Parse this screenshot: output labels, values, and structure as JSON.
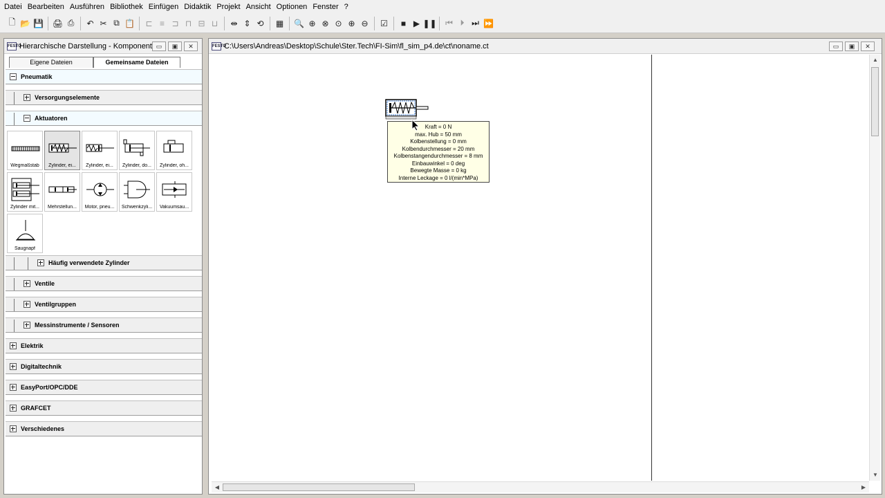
{
  "menu": [
    "Datei",
    "Bearbeiten",
    "Ausführen",
    "Bibliothek",
    "Einfügen",
    "Didaktik",
    "Projekt",
    "Ansicht",
    "Optionen",
    "Fenster",
    "?"
  ],
  "toolbar": {
    "groups": [
      [
        {
          "name": "new-file-icon",
          "glyph": "🗋"
        },
        {
          "name": "open-folder-icon",
          "glyph": "📂"
        },
        {
          "name": "save-icon",
          "glyph": "💾"
        }
      ],
      [
        {
          "name": "print-preview-icon",
          "glyph": "🖨"
        },
        {
          "name": "print-icon",
          "glyph": "⎙"
        }
      ],
      [
        {
          "name": "undo-icon",
          "glyph": "↶"
        },
        {
          "name": "cut-icon",
          "glyph": "✂"
        },
        {
          "name": "copy-icon",
          "glyph": "⧉"
        },
        {
          "name": "paste-icon",
          "glyph": "📋"
        }
      ],
      [
        {
          "name": "align-left-icon",
          "glyph": "⊏",
          "dim": true
        },
        {
          "name": "align-center-icon",
          "glyph": "≡",
          "dim": true
        },
        {
          "name": "align-right-icon",
          "glyph": "⊐",
          "dim": true
        },
        {
          "name": "align-top-icon",
          "glyph": "⊓",
          "dim": true
        },
        {
          "name": "align-middle-icon",
          "glyph": "⊟",
          "dim": true
        },
        {
          "name": "align-bottom-icon",
          "glyph": "⊔",
          "dim": true
        }
      ],
      [
        {
          "name": "flip-horizontal-icon",
          "glyph": "⇹"
        },
        {
          "name": "flip-vertical-icon",
          "glyph": "⇕"
        },
        {
          "name": "rotate-icon",
          "glyph": "⟲"
        }
      ],
      [
        {
          "name": "grid-icon",
          "glyph": "▦"
        }
      ],
      [
        {
          "name": "zoom-icon",
          "glyph": "🔍"
        },
        {
          "name": "zoom-fit-icon",
          "glyph": "⊕"
        },
        {
          "name": "zoom-area-icon",
          "glyph": "⊗"
        },
        {
          "name": "zoom-window-icon",
          "glyph": "⊙"
        },
        {
          "name": "zoom-in-icon",
          "glyph": "⊕"
        },
        {
          "name": "zoom-out-icon",
          "glyph": "⊖"
        }
      ],
      [
        {
          "name": "check-drawing-icon",
          "glyph": "☑"
        }
      ],
      [
        {
          "name": "stop-icon",
          "glyph": "■"
        },
        {
          "name": "play-icon",
          "glyph": "▶"
        },
        {
          "name": "pause-icon",
          "glyph": "❚❚"
        }
      ],
      [
        {
          "name": "reset-icon",
          "glyph": "⏮",
          "dim": true
        },
        {
          "name": "step-icon",
          "glyph": "⏵",
          "dim": true
        },
        {
          "name": "step-forward-icon",
          "glyph": "⏭"
        },
        {
          "name": "fast-forward-icon",
          "glyph": "⏩",
          "dim": true
        }
      ]
    ]
  },
  "left_window": {
    "title": "Hierarchische Darstellung - Komponenten...",
    "buttons": [
      "▭",
      "▣",
      "✕"
    ],
    "tabs": [
      "Eigene Dateien",
      "Gemeinsame Dateien"
    ],
    "tree": {
      "pneumatik": "Pneumatik",
      "versorgung": "Versorgungselemente",
      "aktuatoren": "Aktuatoren",
      "tiles": [
        {
          "label": "Wegmaßstab",
          "icon": "scale-icon"
        },
        {
          "label": "Zylinder, ei...",
          "icon": "cylinder-spring-icon",
          "selected": true
        },
        {
          "label": "Zylinder, ei...",
          "icon": "cylinder-single-icon"
        },
        {
          "label": "Zylinder, do...",
          "icon": "cylinder-double-icon"
        },
        {
          "label": "Zylinder, oh...",
          "icon": "cylinder-rodless-icon"
        },
        {
          "label": "Zylinder mit...",
          "icon": "cylinder-guided-icon"
        },
        {
          "label": "Mehrstellun...",
          "icon": "multiposition-cylinder-icon"
        },
        {
          "label": "Motor, pneu...",
          "icon": "pneumatic-motor-icon"
        },
        {
          "label": "Schwenkzyli...",
          "icon": "swivel-cylinder-icon"
        },
        {
          "label": "Vakuumsau...",
          "icon": "vacuum-icon"
        },
        {
          "label": "Saugnapf",
          "icon": "suction-cup-icon"
        }
      ],
      "haeufig": "Häufig verwendete Zylinder",
      "ventile": "Ventile",
      "ventilgruppen": "Ventilgruppen",
      "messinstrumente": "Messinstrumente / Sensoren",
      "elektrik": "Elektrik",
      "digitaltechnik": "Digitaltechnik",
      "easyport": "EasyPort/OPC/DDE",
      "grafcet": "GRAFCET",
      "verschiedenes": "Verschiedenes"
    }
  },
  "main_window": {
    "title": "C:\\Users\\Andreas\\Desktop\\Schule\\Ster.Tech\\FI-Sim\\fl_sim_p4.de\\ct\\noname.ct",
    "buttons": [
      "▭",
      "▣",
      "✕"
    ],
    "tooltip": [
      "Kraft = 0  N",
      "max. Hub = 50  mm",
      "Kolbenstellung = 0  mm",
      "Kolbendurchmesser = 20  mm",
      "Kolbenstangendurchmesser = 8  mm",
      "Einbauwinkel = 0  deg",
      "Bewegte Masse = 0  kg",
      "Interne Leckage = 0  l/(min*MPa)"
    ]
  }
}
